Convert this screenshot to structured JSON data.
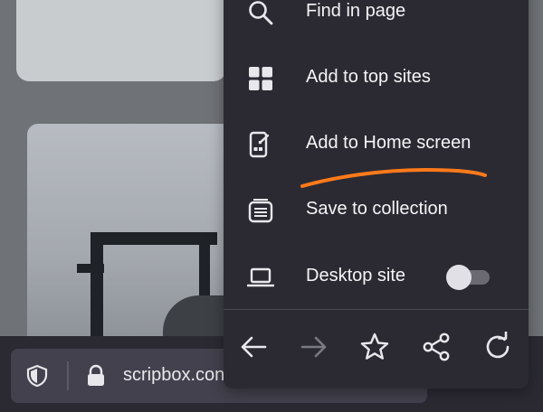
{
  "menu": {
    "items": [
      {
        "label": "Find in page",
        "icon": "search-icon"
      },
      {
        "label": "Add to top sites",
        "icon": "grid-icon"
      },
      {
        "label": "Add to Home screen",
        "icon": "add-to-home-icon"
      },
      {
        "label": "Save to collection",
        "icon": "collection-icon"
      },
      {
        "label": "Desktop site",
        "icon": "laptop-icon",
        "toggle_on": false
      }
    ],
    "nav_icons": [
      "back-arrow-icon",
      "forward-arrow-icon",
      "bookmark-star-icon",
      "share-icon",
      "reload-icon"
    ]
  },
  "address_bar": {
    "url": "scripbox.con"
  },
  "colors": {
    "menu_bg": "#2b2a33",
    "annotation": "#ff7a1a"
  }
}
